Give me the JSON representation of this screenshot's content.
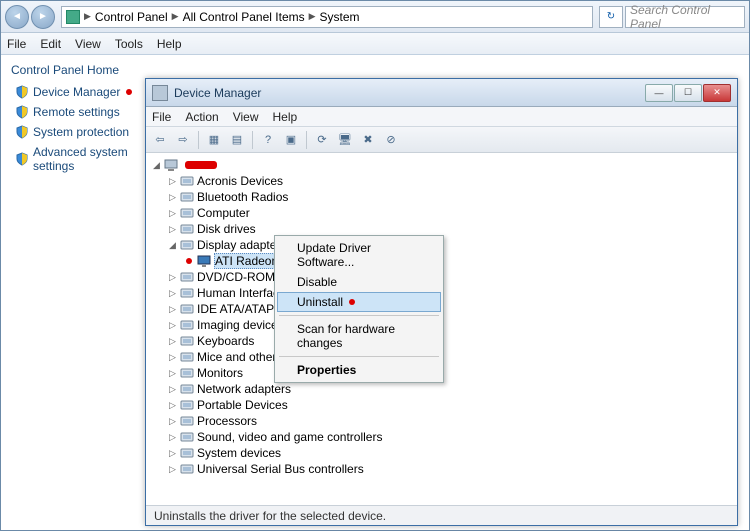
{
  "breadcrumb": {
    "items": [
      "Control Panel",
      "All Control Panel Items",
      "System"
    ]
  },
  "search": {
    "placeholder": "Search Control Panel"
  },
  "main_menu": {
    "items": [
      "File",
      "Edit",
      "View",
      "Tools",
      "Help"
    ]
  },
  "left_pane": {
    "heading": "Control Panel Home",
    "items": [
      {
        "label": "Device Manager",
        "shield": true,
        "dot": true
      },
      {
        "label": "Remote settings",
        "shield": true,
        "dot": false
      },
      {
        "label": "System protection",
        "shield": true,
        "dot": false
      },
      {
        "label": "Advanced system settings",
        "shield": true,
        "dot": false
      }
    ]
  },
  "dm": {
    "title": "Device Manager",
    "menu": [
      "File",
      "Action",
      "View",
      "Help"
    ],
    "status": "Uninstalls the driver for the selected device.",
    "tree": {
      "root_redacted": true,
      "nodes": [
        {
          "label": "Acronis Devices"
        },
        {
          "label": "Bluetooth Radios"
        },
        {
          "label": "Computer"
        },
        {
          "label": "Disk drives"
        },
        {
          "label": "Display adapters",
          "expanded": true,
          "children": [
            {
              "label": "ATI Radeon HD 4800 Series",
              "selected": true,
              "dot": true
            }
          ]
        },
        {
          "label": "DVD/CD-ROM drives"
        },
        {
          "label": "Human Interface Devi"
        },
        {
          "label": "IDE ATA/ATAPI contro"
        },
        {
          "label": "Imaging devices"
        },
        {
          "label": "Keyboards"
        },
        {
          "label": "Mice and other pointi"
        },
        {
          "label": "Monitors"
        },
        {
          "label": "Network adapters"
        },
        {
          "label": "Portable Devices"
        },
        {
          "label": "Processors"
        },
        {
          "label": "Sound, video and game controllers"
        },
        {
          "label": "System devices"
        },
        {
          "label": "Universal Serial Bus controllers"
        }
      ]
    },
    "context_menu": {
      "items": [
        {
          "label": "Update Driver Software..."
        },
        {
          "label": "Disable"
        },
        {
          "label": "Uninstall",
          "hover": true,
          "dot": true
        },
        {
          "sep": true
        },
        {
          "label": "Scan for hardware changes"
        },
        {
          "sep": true
        },
        {
          "label": "Properties",
          "bold": true
        }
      ]
    }
  }
}
